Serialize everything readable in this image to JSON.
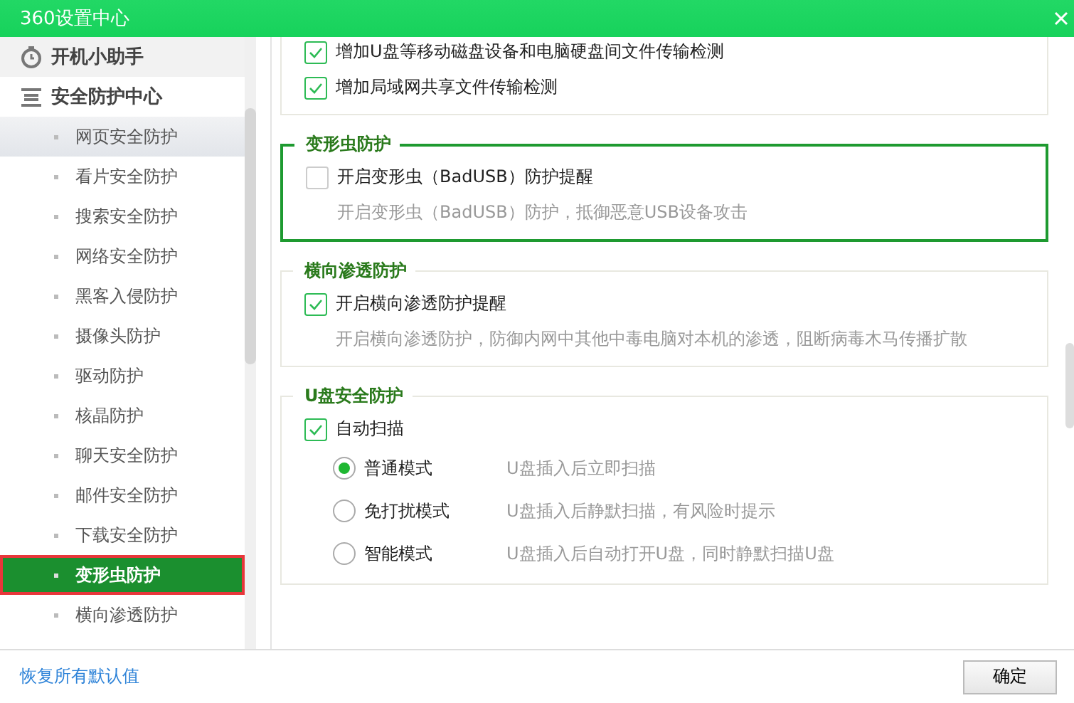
{
  "window": {
    "title": "360设置中心"
  },
  "sidebar": {
    "items": [
      {
        "label": "开机小助手",
        "selected": false
      },
      {
        "label": "安全防护中心",
        "selected": true,
        "children": [
          {
            "label": "网页安全防护",
            "selected": false,
            "hovered": true,
            "outlined": false
          },
          {
            "label": "看片安全防护",
            "selected": false,
            "hovered": false,
            "outlined": false
          },
          {
            "label": "搜索安全防护",
            "selected": false,
            "hovered": false,
            "outlined": false
          },
          {
            "label": "网络安全防护",
            "selected": false,
            "hovered": false,
            "outlined": false
          },
          {
            "label": "黑客入侵防护",
            "selected": false,
            "hovered": false,
            "outlined": false
          },
          {
            "label": "摄像头防护",
            "selected": false,
            "hovered": false,
            "outlined": false
          },
          {
            "label": "驱动防护",
            "selected": false,
            "hovered": false,
            "outlined": false
          },
          {
            "label": "核晶防护",
            "selected": false,
            "hovered": false,
            "outlined": false
          },
          {
            "label": "聊天安全防护",
            "selected": false,
            "hovered": false,
            "outlined": false
          },
          {
            "label": "邮件安全防护",
            "selected": false,
            "hovered": false,
            "outlined": false
          },
          {
            "label": "下载安全防护",
            "selected": false,
            "hovered": false,
            "outlined": false
          },
          {
            "label": "变形虫防护",
            "selected": true,
            "hovered": false,
            "outlined": true
          },
          {
            "label": "横向渗透防护",
            "selected": false,
            "hovered": false,
            "outlined": false
          }
        ]
      }
    ]
  },
  "sections": [
    {
      "active": false,
      "items": [
        {
          "kind": "checkbox",
          "label": "增加U盘等移动磁盘设备和电脑硬盘间文件传输检测",
          "checked": true
        },
        {
          "kind": "checkbox",
          "label": "增加局域网共享文件传输检测",
          "checked": true
        }
      ]
    },
    {
      "title": "变形虫防护",
      "active": true,
      "items": [
        {
          "kind": "checkbox",
          "label": "开启变形虫（BadUSB）防护提醒",
          "checked": false,
          "description": "开启变形虫（BadUSB）防护，抵御恶意USB设备攻击"
        }
      ]
    },
    {
      "title": "横向渗透防护",
      "active": false,
      "items": [
        {
          "kind": "checkbox",
          "label": "开启横向渗透防护提醒",
          "checked": true,
          "description": "开启横向渗透防护，防御内网中其他中毒电脑对本机的渗透，阻断病毒木马传播扩散"
        }
      ]
    },
    {
      "title": "U盘安全防护",
      "active": false,
      "items": [
        {
          "kind": "checkbox",
          "label": "自动扫描",
          "checked": true
        },
        {
          "kind": "radio",
          "label": "普通模式",
          "selected": true,
          "description": "U盘插入后立即扫描"
        },
        {
          "kind": "radio",
          "label": "免打扰模式",
          "selected": false,
          "description": "U盘插入后静默扫描，有风险时提示"
        },
        {
          "kind": "radio",
          "label": "智能模式",
          "selected": false,
          "description": "U盘插入后自动打开U盘，同时静默扫描U盘"
        }
      ]
    }
  ],
  "footer": {
    "link": "恢复所有默认值",
    "button": "确定"
  }
}
